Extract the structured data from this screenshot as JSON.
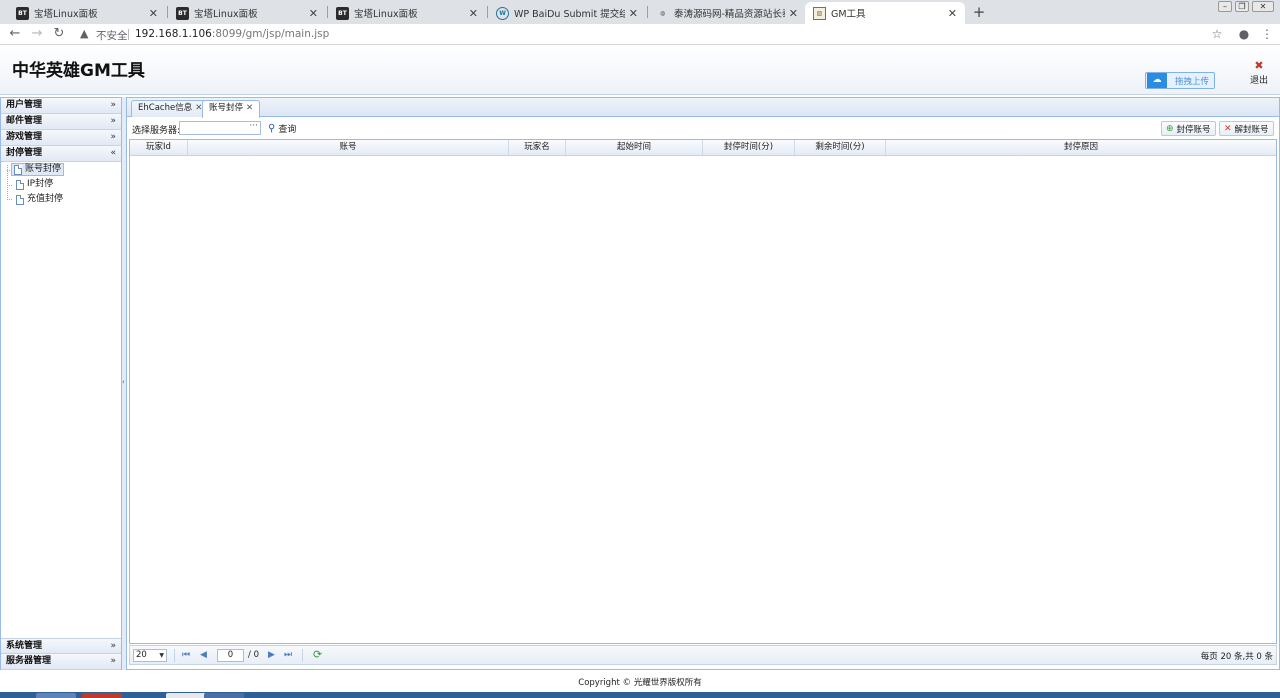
{
  "browser": {
    "tabs": [
      {
        "label": "宝塔Linux面板",
        "favicon": "bt-icon"
      },
      {
        "label": "宝塔Linux面板",
        "favicon": "bt-icon"
      },
      {
        "label": "宝塔Linux面板",
        "favicon": "bt-icon"
      },
      {
        "label": "WP BaiDu Submit 提交结果 - 思",
        "favicon": "wordpress-icon"
      },
      {
        "label": "泰涛源码网-精品资源站长泰涛",
        "favicon": "globe-icon"
      },
      {
        "label": "GM工具",
        "favicon": "page-icon",
        "active": true
      }
    ],
    "new_tab": "+",
    "insecure_label": "不安全",
    "url_host": "192.168.1.106",
    "url_rest": ":8099/gm/jsp/main.jsp"
  },
  "header": {
    "title": "中华英雄GM工具",
    "upload_label": "拖拽上传",
    "logout_label": "退出"
  },
  "sidebar": {
    "sections": [
      {
        "label": "用户管理",
        "expanded": false
      },
      {
        "label": "邮件管理",
        "expanded": false
      },
      {
        "label": "游戏管理",
        "expanded": false
      },
      {
        "label": "封停管理",
        "expanded": true
      }
    ],
    "items": [
      {
        "label": "账号封停",
        "selected": true
      },
      {
        "label": "IP封停"
      },
      {
        "label": "充值封停"
      }
    ],
    "bottom_sections": [
      {
        "label": "系统管理"
      },
      {
        "label": "服务器管理"
      }
    ],
    "chev_down": "»",
    "chev_up": "«"
  },
  "main": {
    "tabs": [
      {
        "label": "EhCache信息"
      },
      {
        "label": "账号封停",
        "active": true
      }
    ],
    "toolbar": {
      "server_label": "选择服务器:",
      "server_value": "",
      "query_label": "查询",
      "ban_label": "封停账号",
      "unban_label": "解封账号"
    },
    "grid": {
      "columns": [
        "玩家Id",
        "账号",
        "玩家名",
        "起始时间",
        "封停时间(分)",
        "剩余时间(分)",
        "封停原因"
      ],
      "rows": []
    },
    "pager": {
      "page_size": "20",
      "current_page": "0",
      "total_pages": "/ 0",
      "info": "每页 20 条,共 0 条"
    }
  },
  "footer": {
    "copyright": "Copyright © 光耀世界版权所有"
  },
  "colors": {
    "panel_border": "#99bbe8",
    "header_gradient_end": "#eef2f8",
    "taskbar": "#2f5f97",
    "accent_blue": "#2b8de0"
  }
}
